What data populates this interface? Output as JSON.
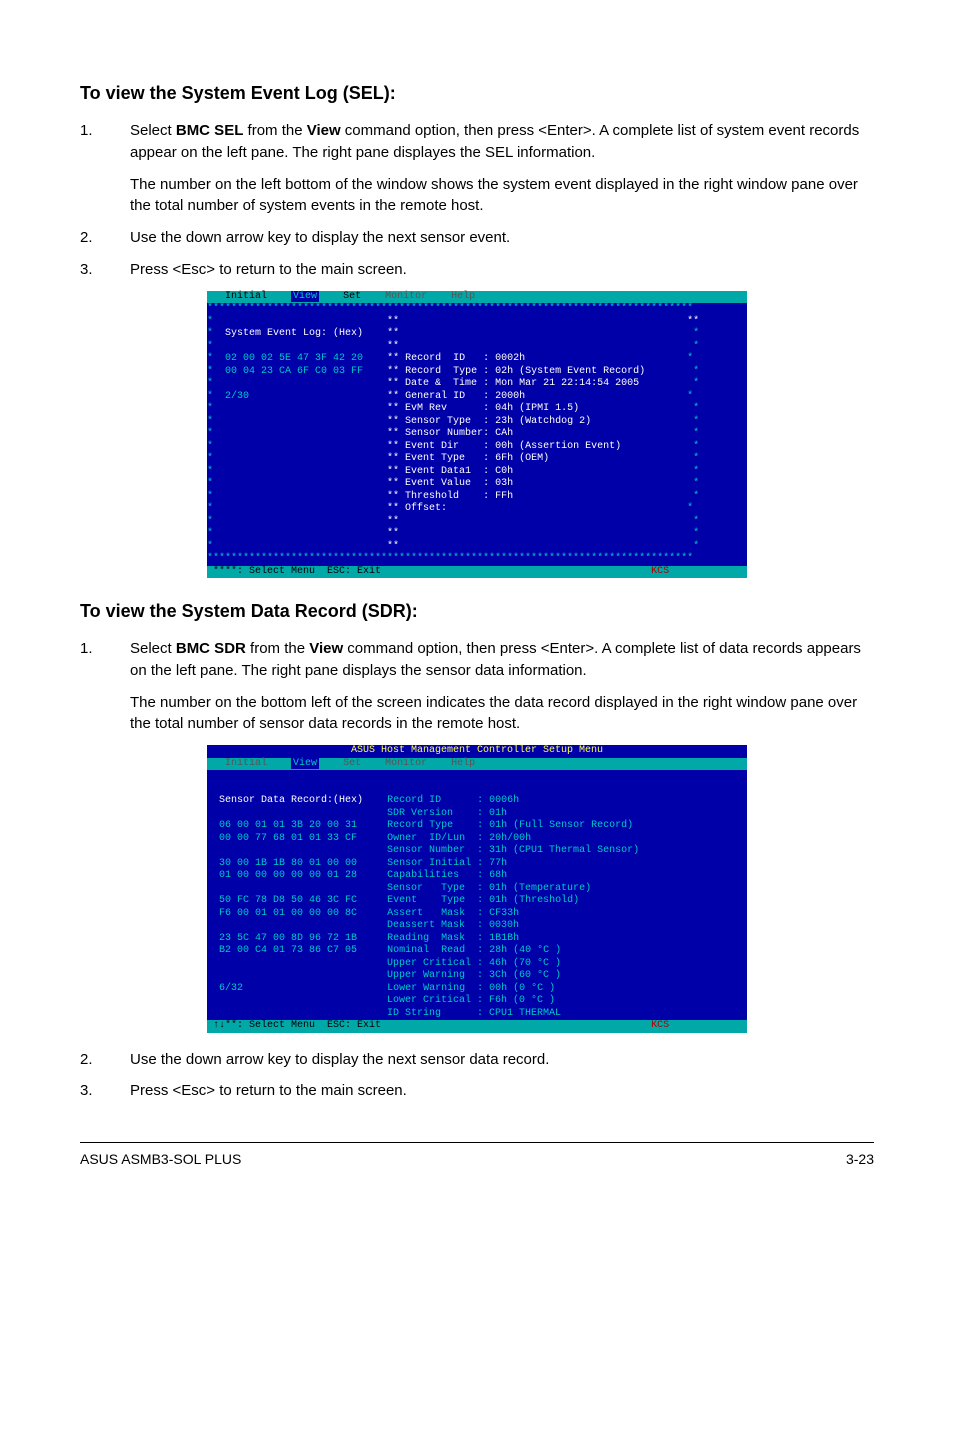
{
  "sel": {
    "heading": "To view the System Event Log (SEL):",
    "step1_pre": "Select ",
    "step1_bold1": "BMC SEL",
    "step1_mid": " from the ",
    "step1_bold2": "View",
    "step1_post": " command option, then press <Enter>. A complete list of system event records appear on the left pane. The right pane displayes the SEL information.",
    "step1_para2": "The number on the left bottom of the window shows the system event displayed in the right window pane over the total number of system events in the remote host.",
    "step2": "Use the down arrow key to display the next sensor event.",
    "step3": "Press <Esc> to return to the main screen."
  },
  "sdr": {
    "heading": "To view the System Data Record (SDR):",
    "step1_pre": "Select ",
    "step1_bold1": "BMC SDR",
    "step1_mid": " from the ",
    "step1_bold2": "View",
    "step1_post": " command option, then press <Enter>. A complete list of data records appears on the left pane. The right pane displays the sensor data information.",
    "step1_para2": "The number on the bottom left of the screen indicates the data record displayed in the right window pane over the total number of sensor data records in the remote host.",
    "step2": "Use the down arrow key to display the next sensor data record.",
    "step3": "Press <Esc> to return to the main screen."
  },
  "terminal1": {
    "menubar": "   Initial    View    Set    Monitor    Help                                   ",
    "left_title": "System Event Log: (Hex)",
    "hex1": "02 00 02 5E 47 3F 42 20",
    "hex2": "00 04 23 CA 6F C0 03 FF",
    "count": "2/30",
    "r0": "**                                                **",
    "r1": "** Record  ID   : 0002h",
    "r2": "** Record  Type : 02h (System Event Record)",
    "r3": "** Date &  Time : Mon Mar 21 22:14:54 2005",
    "r4": "** General ID   : 2000h",
    "r5": "** EvM Rev      : 04h (IPMI 1.5)",
    "r6": "** Sensor Type  : 23h (Watchdog 2)",
    "r7": "** Sensor Number: CAh",
    "r8": "** Event Dir    : 00h (Assertion Event)",
    "r9": "** Event Type   : 6Fh (OEM)",
    "r10": "** Event Data1  : C0h",
    "r11": "** Event Value  : 03h",
    "r12": "** Threshold    : FFh",
    "r13": "** Offset:",
    "status": "****: Select Menu  ESC: Exit                                             KCS "
  },
  "terminal2": {
    "title": "ASUS Host Management Controller Setup Menu",
    "menubar": "   Initial    View    Set    Monitor    Help                                   ",
    "left_title": "Sensor Data Record:(Hex)",
    "hex1": "06 00 01 01 3B 20 00 31",
    "hex2": "00 00 77 68 01 01 33 CF",
    "hex3": "30 00 1B 1B 80 01 00 00",
    "hex4": "01 00 00 00 00 00 01 28",
    "hex5": "50 FC 78 D8 50 46 3C FC",
    "hex6": "F6 00 01 01 00 00 00 8C",
    "hex7": "23 5C 47 00 8D 96 72 1B",
    "hex8": "B2 00 C4 01 73 86 C7 05",
    "count": "6/32",
    "r1": "Record ID      : 0006h",
    "r2": "SDR Version    : 01h",
    "r3": "Record Type    : 01h (Full Sensor Record)",
    "r4": "Owner  ID/Lun  : 20h/00h",
    "r5": "Sensor Number  : 31h (CPU1 Thermal Sensor)",
    "r6": "Sensor Initial : 77h",
    "r7": "Capabilities   : 68h",
    "r8": "Sensor   Type  : 01h (Temperature)",
    "r9": "Event    Type  : 01h (Threshold)",
    "r10": "Assert   Mask  : CF33h",
    "r11": "Deassert Mask  : 0030h",
    "r12": "Reading  Mask  : 1B1Bh",
    "r13": "Nominal  Read  : 28h (40 °C )",
    "r14": "Upper Critical : 46h (70 °C )",
    "r15": "Upper Warning  : 3Ch (60 °C )",
    "r16": "Lower Warning  : 00h (0 °C )",
    "r17": "Lower Critical : F6h (0 °C )",
    "r18": "ID String      : CPU1 THERMAL",
    "status": "↑↓**: Select Menu  ESC: Exit                                             KCS "
  },
  "footer": {
    "left": "ASUS ASMB3-SOL PLUS",
    "right": "3-23"
  }
}
